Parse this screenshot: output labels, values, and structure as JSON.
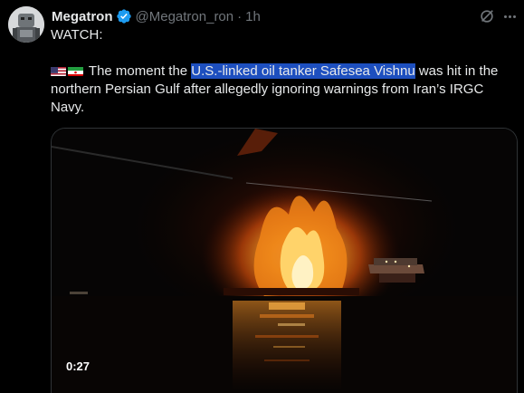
{
  "post": {
    "author_name": "Megatron",
    "author_handle": "@Megatron_ron",
    "separator": "·",
    "time_ago": "1h",
    "icons": {
      "verified": "verified-badge-icon",
      "grok": "grok-icon",
      "more": "more-options-icon"
    },
    "text_line1": "WATCH:",
    "flags": [
      "us-flag-icon",
      "iran-flag-icon"
    ],
    "text_before": "The moment the ",
    "text_highlighted": "U.S.-linked oil tanker Safesea Vishnu",
    "text_after": " was hit in the northern Persian Gulf after allegedly ignoring warnings from Iran’s IRGC Navy."
  },
  "video": {
    "duration": "0:27"
  },
  "colors": {
    "background": "#000000",
    "text": "#e7e9ea",
    "muted": "#71767b",
    "verified": "#1d9bf0",
    "highlight": "#1d4fbf"
  }
}
